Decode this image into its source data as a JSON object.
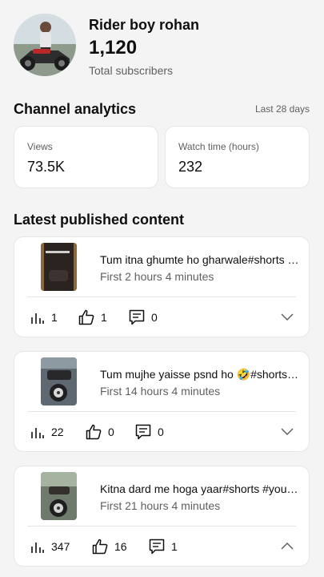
{
  "channel": {
    "name": "Rider boy rohan",
    "subscriber_count": "1,120",
    "subscriber_label": "Total subscribers"
  },
  "analytics": {
    "title": "Channel analytics",
    "period": "Last 28 days",
    "views": {
      "label": "Views",
      "value": "73.5K"
    },
    "watch_time": {
      "label": "Watch time (hours)",
      "value": "232"
    }
  },
  "latest": {
    "title": "Latest published content",
    "videos": [
      {
        "title": "Tum itna ghumte ho gharwale#shorts #youtubeshorts",
        "age": "First 2 hours 4 minutes",
        "views": "1",
        "likes": "1",
        "comments": "0",
        "expanded": false
      },
      {
        "title": "Tum mujhe yaisse psnd ho 🤣#shorts #youtubeshorts",
        "age": "First 14 hours 4 minutes",
        "views": "22",
        "likes": "0",
        "comments": "0",
        "expanded": false
      },
      {
        "title": "Kitna dard me hoga yaar#shorts #youtubeshorts",
        "age": "First 21 hours 4 minutes",
        "views": "347",
        "likes": "16",
        "comments": "1",
        "expanded": true
      }
    ]
  },
  "icons": {
    "views": "bar-chart-icon",
    "likes": "thumbs-up-icon",
    "comments": "comment-icon",
    "expand": "chevron-icon"
  }
}
